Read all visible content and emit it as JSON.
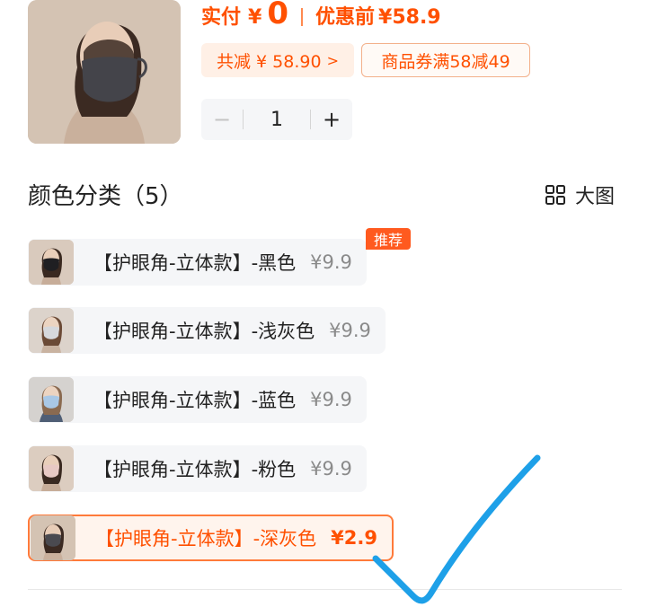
{
  "product": {
    "image_icon": "mask-model-photo",
    "price_label": "实付",
    "currency": "¥",
    "price_value": "0",
    "orig_label": "优惠前",
    "orig_value": "¥58.9",
    "discount_text": "共减 ¥ 58.90",
    "discount_chevron": ">",
    "coupon_text": "商品券满58减49",
    "quantity": "1",
    "minus_label": "−",
    "plus_label": "+"
  },
  "colors": {
    "accent": "#ff5000",
    "check": "#1ea0e8"
  },
  "section": {
    "title": "颜色分类（5）",
    "view_label": "大图",
    "view_icon": "grid-icon"
  },
  "options": [
    {
      "name": "【护眼角-立体款】-黑色",
      "price": "¥9.9",
      "badge": "推荐",
      "mask_color": "#1f1f22"
    },
    {
      "name": "【护眼角-立体款】-浅灰色",
      "price": "¥9.9",
      "mask_color": "#d6d8dc"
    },
    {
      "name": "【护眼角-立体款】-蓝色",
      "price": "¥9.9",
      "mask_color": "#a9c8e6"
    },
    {
      "name": "【护眼角-立体款】-粉色",
      "price": "¥9.9",
      "mask_color": "#e8c9c4"
    },
    {
      "name": "【护眼角-立体款】-深灰色",
      "price": "¥2.9",
      "mask_color": "#4a4a50",
      "selected": true
    }
  ]
}
